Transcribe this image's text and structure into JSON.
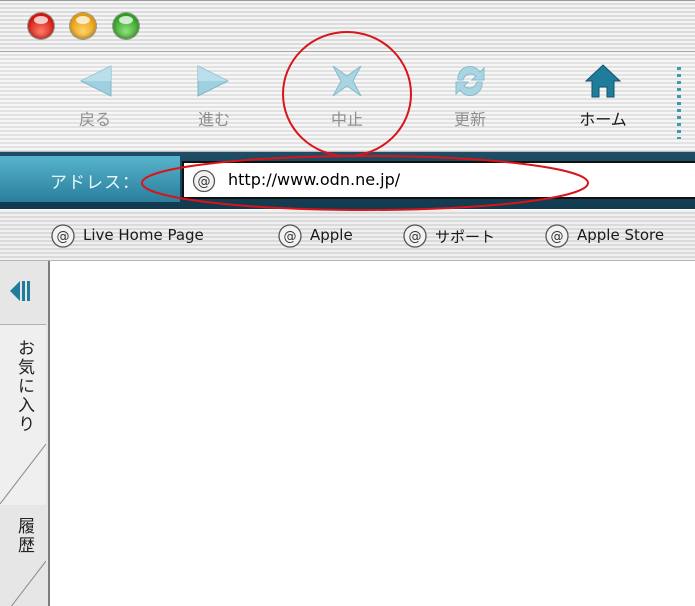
{
  "window": {
    "buttons": [
      "close",
      "minimize",
      "zoom"
    ]
  },
  "toolbar": {
    "back_label": "戻る",
    "forward_label": "進む",
    "stop_label": "中止",
    "refresh_label": "更新",
    "home_label": "ホーム",
    "icons": [
      "back-icon",
      "forward-icon",
      "stop-icon",
      "refresh-icon",
      "home-icon"
    ]
  },
  "address": {
    "label": "アドレス：",
    "url": "http://www.odn.ne.jp/",
    "icon": "at-icon"
  },
  "favorites": {
    "items": [
      {
        "label": "Live Home Page"
      },
      {
        "label": "Apple"
      },
      {
        "label": "サポート"
      },
      {
        "label": "Apple Store"
      }
    ]
  },
  "sidebar": {
    "tabs": [
      "お気に入り",
      "履歴"
    ]
  },
  "colors": {
    "accent": "#2a7e9c",
    "annotation": "#d9141b",
    "address_bar": "#123a4f"
  }
}
